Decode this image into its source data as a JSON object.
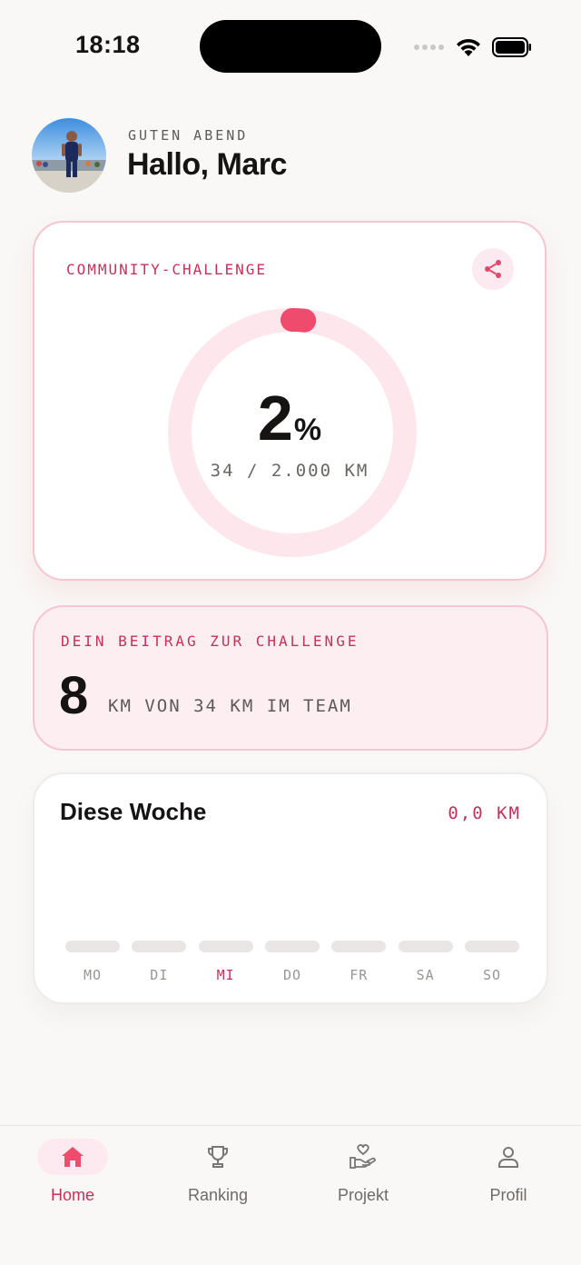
{
  "status_bar": {
    "time": "18:18"
  },
  "header": {
    "greeting_small": "GUTEN ABEND",
    "greeting_big": "Hallo, Marc"
  },
  "challenge": {
    "label": "COMMUNITY-CHALLENGE",
    "percent": "2",
    "percent_sign": "%",
    "progress_fraction": 0.017,
    "progress_text": "34 / 2.000 KM"
  },
  "contribution": {
    "label": "DEIN BEITRAG ZUR CHALLENGE",
    "value": "8",
    "text": "KM VON 34 KM IM TEAM"
  },
  "week": {
    "title": "Diese Woche",
    "total": "0,0 KM",
    "days": [
      {
        "label": "MO",
        "active": false
      },
      {
        "label": "DI",
        "active": false
      },
      {
        "label": "MI",
        "active": true
      },
      {
        "label": "DO",
        "active": false
      },
      {
        "label": "FR",
        "active": false
      },
      {
        "label": "SA",
        "active": false
      },
      {
        "label": "SO",
        "active": false
      }
    ]
  },
  "tabs": [
    {
      "label": "Home",
      "icon": "home-icon",
      "active": true
    },
    {
      "label": "Ranking",
      "icon": "trophy-icon",
      "active": false
    },
    {
      "label": "Projekt",
      "icon": "heart-hand-icon",
      "active": false
    },
    {
      "label": "Profil",
      "icon": "user-icon",
      "active": false
    }
  ],
  "colors": {
    "accent": "#c3325a",
    "accent_bright": "#ef4b6c",
    "accent_soft": "#fdeaf0",
    "ring_track": "#fde7ec",
    "background": "#f9f8f6"
  }
}
